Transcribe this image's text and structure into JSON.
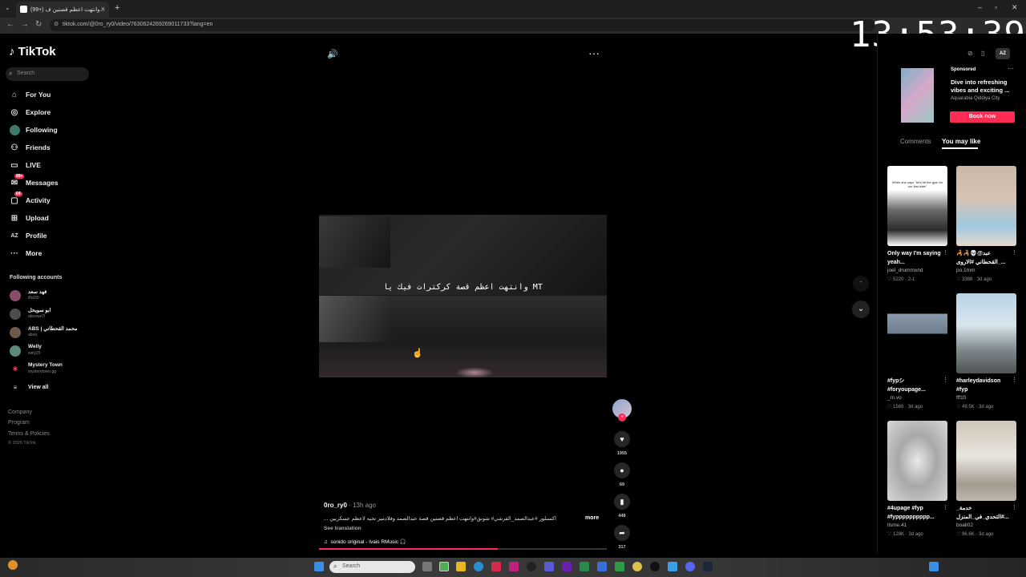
{
  "browser": {
    "tab_title": "(99+) وانتهت اعظم قصتين ف...",
    "url": "tiktok.com/@0ro_ry0/video/7630624269269011733?lang=en",
    "clock": "13:53:39"
  },
  "sidebar": {
    "logo": "TikTok",
    "search_placeholder": "Search",
    "nav": [
      {
        "label": "For You",
        "icon": "home-icon"
      },
      {
        "label": "Explore",
        "icon": "compass-icon"
      },
      {
        "label": "Following",
        "icon": "following-icon"
      },
      {
        "label": "Friends",
        "icon": "friends-icon"
      },
      {
        "label": "LIVE",
        "icon": "live-icon"
      },
      {
        "label": "Messages",
        "icon": "message-icon",
        "badge": "99+"
      },
      {
        "label": "Activity",
        "icon": "activity-icon",
        "badge": "64"
      },
      {
        "label": "Upload",
        "icon": "upload-icon"
      },
      {
        "label": "Profile",
        "icon": "profile-icon"
      },
      {
        "label": "More",
        "icon": "more-icon"
      }
    ],
    "following_title": "Following accounts",
    "accounts": [
      {
        "name": "فهد سعد",
        "handle": "ifhd39"
      },
      {
        "name": "ابو سويحل",
        "handle": "abuswe7l"
      },
      {
        "name": "ABS | محمد القحطاني",
        "handle": "absq"
      },
      {
        "name": "Welly",
        "handle": "wely20"
      },
      {
        "name": "Mystery Town",
        "handle": "mysterytown.gg"
      }
    ],
    "view_all": "View all",
    "footer": [
      "Company",
      "Program",
      "Terms & Policies"
    ],
    "copyright": "© 2026 TikTok"
  },
  "video": {
    "caption": "وانتهت اعظم قصة كركترات فيك يا MT",
    "author": "0ro_ry0",
    "time": "· 13h ago",
    "description": "اكسبلور #عبدالصمد_القرشي# شونق#وانتهت اعظم قصتين قصة عبدالصمد وفلادمير تحيه لاعظم عسكريين ...",
    "more": "more",
    "see_translation": "See translation",
    "music": "sonido original - Ivais RMusic",
    "progress": 0.62,
    "counts": {
      "likes": "1955",
      "comments": "69",
      "saves": "448",
      "shares": "317"
    }
  },
  "right_panel": {
    "ad": {
      "sponsored": "Sponsored",
      "title": "Dive into refreshing vibes and exciting ...",
      "subtitle": "Aquarabia Qiddiya City",
      "cta": "Book now"
    },
    "tabs": [
      "Comments",
      "You may like"
    ],
    "cards": [
      {
        "title": "Only way I'm saying yeah...",
        "author": "joel_drummxnd",
        "stats": "♡ 5220 · 2-1",
        "thumb_text": "When she says \"let's hit the gym for our first date\""
      },
      {
        "title": "🦂🦂💀@عبد القحطاني #الاروى_...",
        "author": "po.1mm",
        "stats": "♡ 3388 · 3d ago"
      },
      {
        "title": "#fypシ #foryoupage...",
        "author": "_m.vo",
        "stats": "♡ 1569 · 3d ago"
      },
      {
        "title": "#harleydavidson #fyp",
        "author": "fff1fi",
        "stats": "♡ 49.5K · 3d ago"
      },
      {
        "title": "#4upage #fyp #fypppppppppp...",
        "author": "llsme.41",
        "stats": "♡ 128K · 3d ago"
      },
      {
        "title": "خدمة_ #التحدي_في_المنزل...",
        "author": "boali02",
        "stats": "♡ 96.6K · 3d ago"
      }
    ]
  },
  "taskbar": {
    "search_placeholder": "Search"
  }
}
